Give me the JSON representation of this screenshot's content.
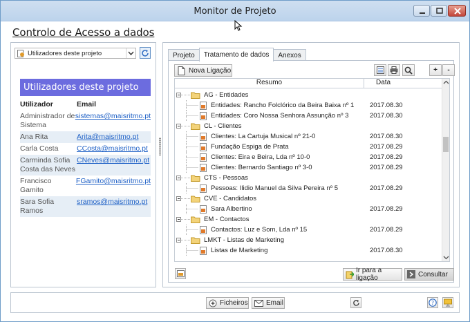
{
  "window": {
    "title": "Monitor de Projeto"
  },
  "page": {
    "heading": "Controlo de Acesso a dados"
  },
  "left": {
    "select_value": "Utilizadores deste projeto",
    "users_header": "Utilizadores deste projeto",
    "columns": [
      "Utilizador",
      "Email"
    ],
    "users": [
      {
        "name": "Administrador de Sistema",
        "email": "sistemas@maisritmo.pt"
      },
      {
        "name": "Ana Rita",
        "email": "Arita@maisritmo.pt"
      },
      {
        "name": "Carla Costa",
        "email": "CCosta@maisritmo.pt"
      },
      {
        "name": "Carminda Sofia Costa das Neves",
        "email": "CNeves@maisritmo.pt"
      },
      {
        "name": "Francisco Gamito",
        "email": "FGamito@maisritmo.pt"
      },
      {
        "name": "Sara Sofia Ramos",
        "email": "sramos@maisritmo.pt"
      }
    ]
  },
  "tabs": [
    {
      "label": "Projeto",
      "active": false
    },
    {
      "label": "Tratamento de dados",
      "active": true
    },
    {
      "label": "Anexos",
      "active": false
    }
  ],
  "toolbar": {
    "nova_label": "Nova Ligação",
    "plus": "+",
    "minus": "-"
  },
  "tree": {
    "columns": [
      "Resumo",
      "Data"
    ],
    "rows": [
      {
        "type": "group",
        "label": "AG - Entidades"
      },
      {
        "type": "leaf",
        "label": "Entidades: Rancho Folclórico da Beira Baixa nº 1",
        "date": "2017.08.30"
      },
      {
        "type": "leaf",
        "label": "Entidades: Coro Nossa Senhora Assunção nº 3",
        "date": "2017.08.30"
      },
      {
        "type": "group",
        "label": "CL - Clientes"
      },
      {
        "type": "leaf",
        "label": "Clientes: La Cartuja Musical nº 21-0",
        "date": "2017.08.30"
      },
      {
        "type": "leaf",
        "label": "Fundação Espiga de Prata",
        "date": "2017.08.29"
      },
      {
        "type": "leaf",
        "label": "Clientes: Eira e Beira, Lda nº 10-0",
        "date": "2017.08.29"
      },
      {
        "type": "leaf",
        "label": "Clientes: Bernardo Santiago nº 3-0",
        "date": "2017.08.29"
      },
      {
        "type": "group",
        "label": "CTS - Pessoas"
      },
      {
        "type": "leaf",
        "label": "Pessoas: Ilidio Manuel da Silva Pereira nº 5",
        "date": "2017.08.29"
      },
      {
        "type": "group",
        "label": "CVE - Candidatos"
      },
      {
        "type": "leaf",
        "label": "Sara Albertino",
        "date": "2017.08.29"
      },
      {
        "type": "group",
        "label": "EM - Contactos"
      },
      {
        "type": "leaf",
        "label": "Contactos: Luz e Som, Lda nº 15",
        "date": "2017.08.29"
      },
      {
        "type": "group",
        "label": "LMKT - Listas de Marketing"
      },
      {
        "type": "leaf",
        "label": "Listas de Marketing",
        "date": "2017.08.30"
      }
    ]
  },
  "actions": {
    "ir_para": "Ir para a ligação",
    "consultar": "Consultar"
  },
  "bottom": {
    "ficheiros": "Ficheiros",
    "email": "Email"
  }
}
